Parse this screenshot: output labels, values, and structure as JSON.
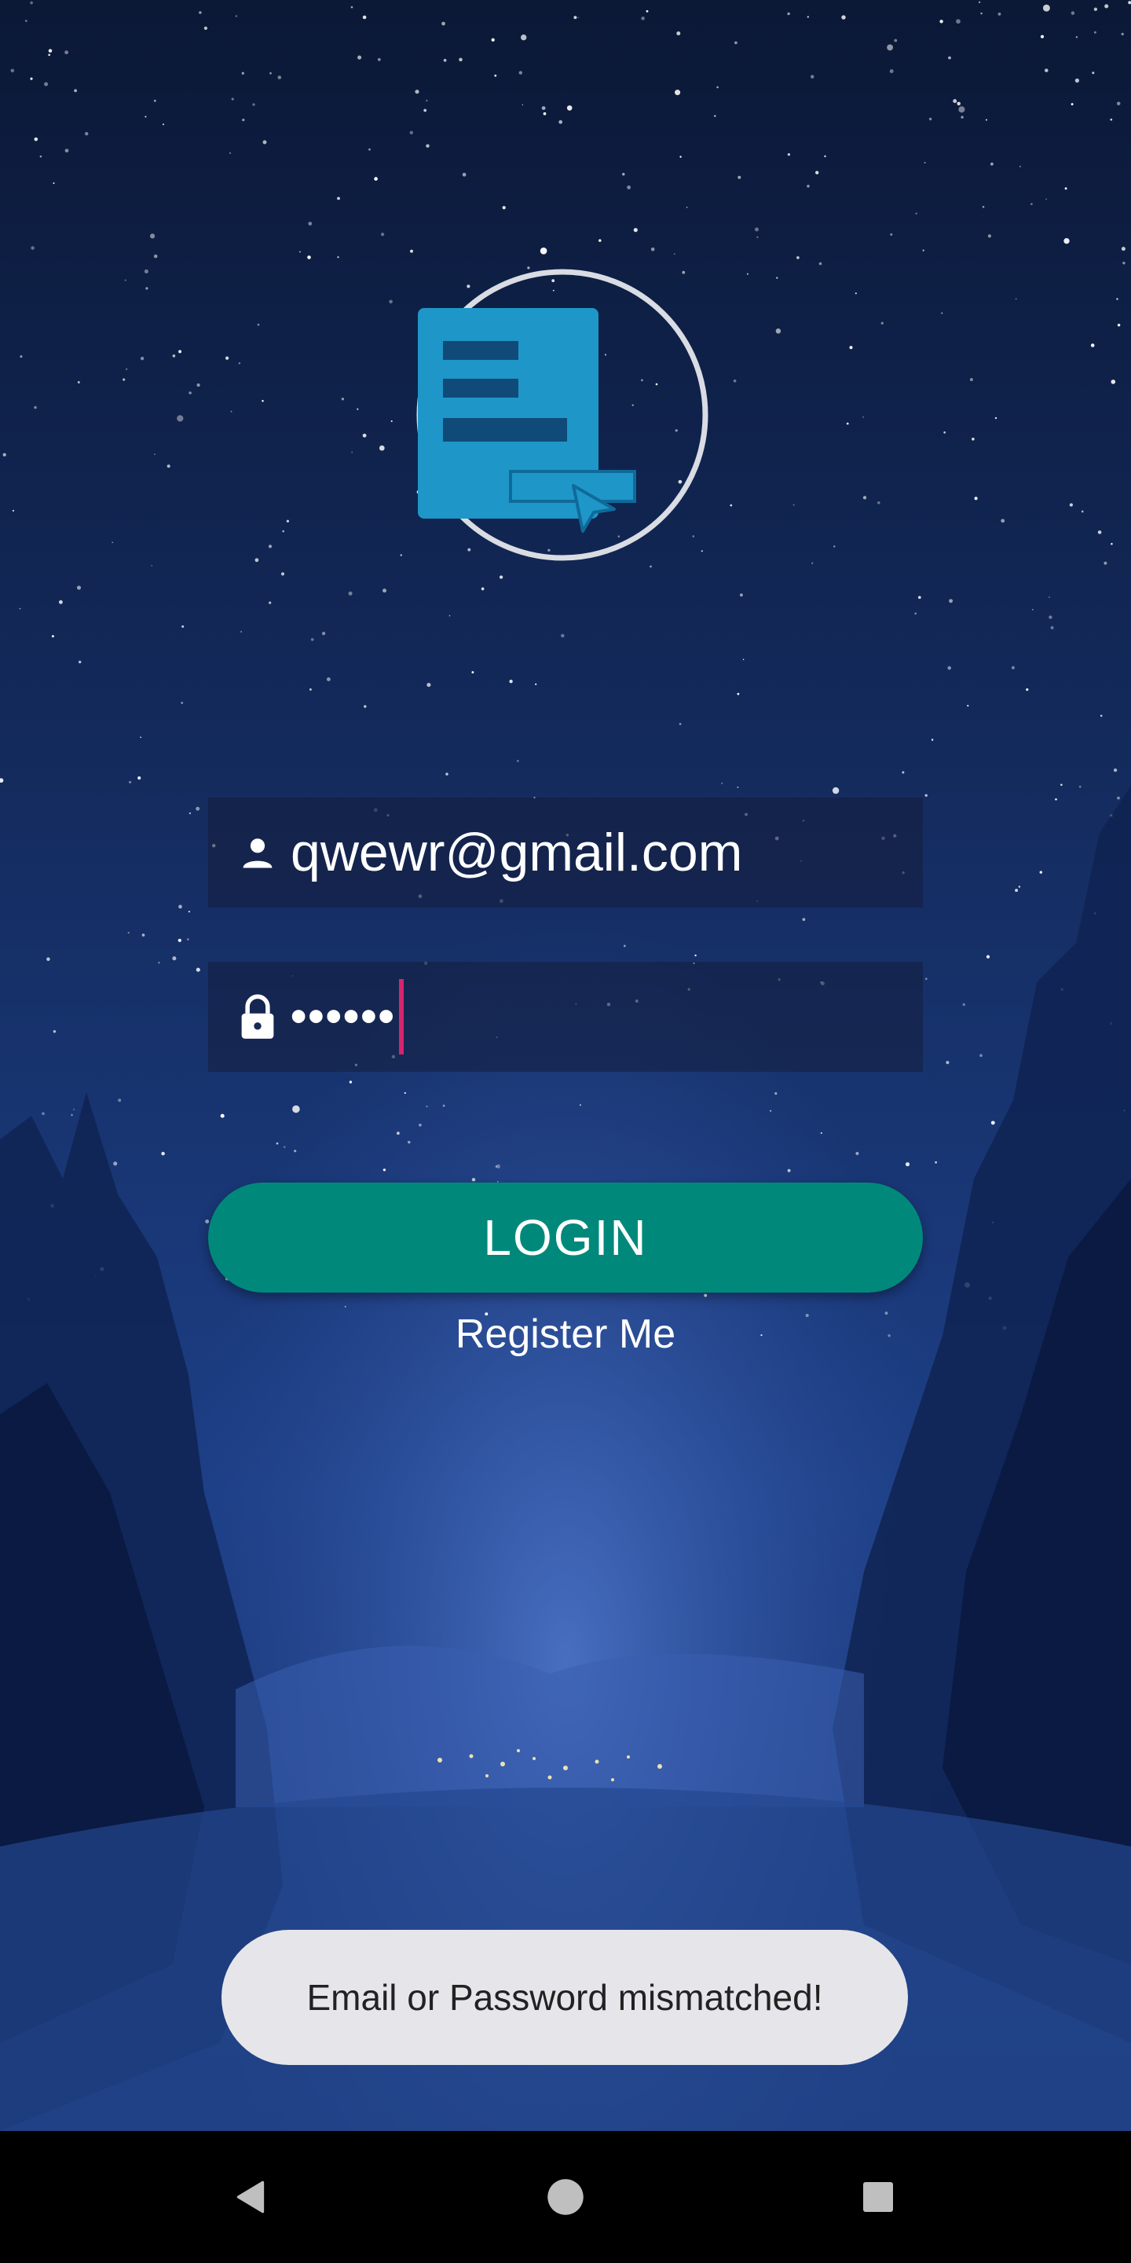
{
  "login": {
    "email_value": "qwewr@gmail.com",
    "password_masked": "••••••",
    "login_label": "LOGIN",
    "register_label": "Register Me"
  },
  "toast": {
    "message": "Email or Password mismatched!"
  },
  "icons": {
    "email": "person-icon",
    "password": "lock-icon",
    "logo": "form-cursor-logo"
  },
  "colors": {
    "accent_button": "#00897b",
    "caret": "#d6246e",
    "logo_blue": "#1e96c8",
    "background": "#0c1a3c"
  }
}
